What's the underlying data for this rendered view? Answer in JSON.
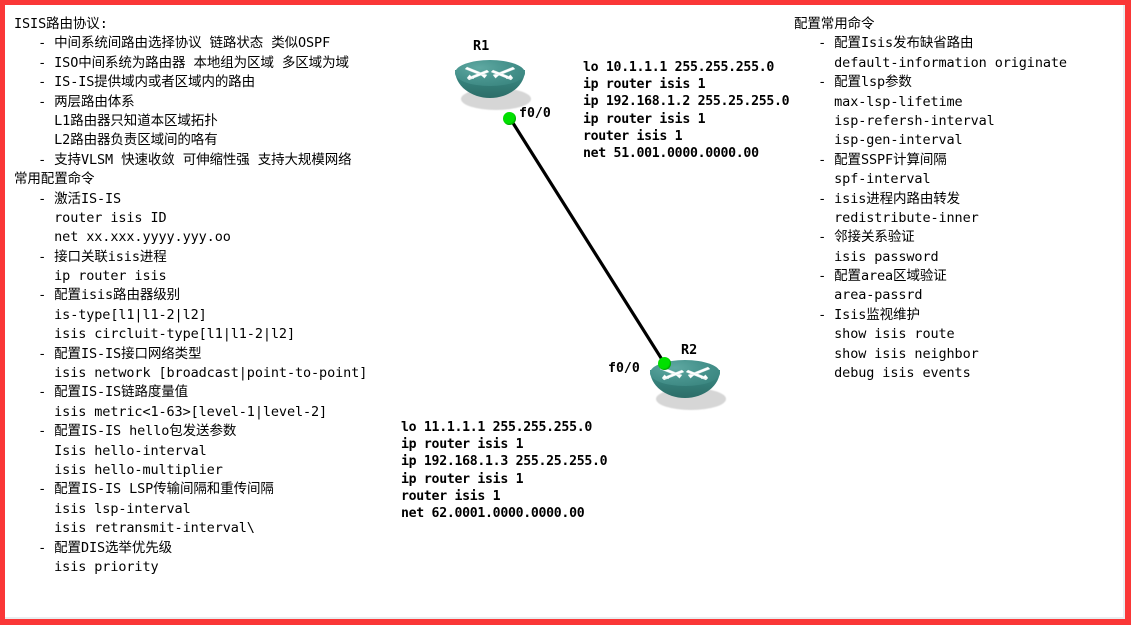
{
  "theme": {
    "frame_color": "#fa3737",
    "canvas_color": "#ffffff",
    "router_color": "#35807a",
    "link_color": "#000000",
    "status_dot_color": "#00e000"
  },
  "left_notes": {
    "lines": [
      "ISIS路由协议:",
      "   - 中间系统间路由选择协议 链路状态 类似OSPF",
      "   - ISO中间系统为路由器 本地组为区域 多区域为域",
      "   - IS-IS提供域内或者区域内的路由",
      "   - 两层路由体系",
      "     L1路由器只知道本区域拓扑",
      "     L2路由器负责区域间的咯有",
      "   - 支持VLSM 快速收敛 可伸缩性强 支持大规模网络",
      "常用配置命令",
      "   - 激活IS-IS",
      "     router isis ID",
      "     net xx.xxx.yyyy.yyy.oo",
      "   - 接口关联isis进程",
      "     ip router isis",
      "   - 配置isis路由器级别",
      "     is-type[l1|l1-2|l2]",
      "     isis circluit-type[l1|l1-2|l2]",
      "   - 配置IS-IS接口网络类型",
      "     isis network [broadcast|point-to-point]",
      "   - 配置IS-IS链路度量值",
      "     isis metric<1-63>[level-1|level-2]",
      "   - 配置IS-IS hello包发送参数",
      "     Isis hello-interval",
      "     isis hello-multiplier",
      "   - 配置IS-IS LSP传输间隔和重传间隔",
      "     isis lsp-interval",
      "     isis retransmit-interval\\",
      "   - 配置DIS选举优先级",
      "     isis priority"
    ]
  },
  "right_notes": {
    "lines": [
      "配置常用命令",
      "   - 配置Isis发布缺省路由",
      "     default-information originate",
      "   - 配置lsp参数",
      "     max-lsp-lifetime",
      "     isp-refersh-interval",
      "     isp-gen-interval",
      "   - 配置SSPF计算间隔",
      "     spf-interval",
      "   - isis进程内路由转发",
      "     redistribute-inner",
      "   - 邻接关系验证",
      "     isis password",
      "   - 配置area区域验证",
      "     area-passrd",
      "   - Isis监视维护",
      "     show isis route",
      "     show isis neighbor",
      "     debug isis events"
    ]
  },
  "topology": {
    "routers": [
      {
        "id": "R1",
        "label": "R1",
        "interface_label": "f0/0"
      },
      {
        "id": "R2",
        "label": "R2",
        "interface_label": "f0/0"
      }
    ],
    "link": {
      "from": "R1",
      "to": "R2",
      "interface_a": "f0/0",
      "interface_b": "f0/0"
    }
  },
  "r1_config": {
    "lines": [
      "lo 10.1.1.1 255.255.255.0",
      "ip router isis 1",
      "ip 192.168.1.2 255.25.255.0",
      "ip router isis 1",
      "router isis 1",
      "net 51.001.0000.0000.00"
    ]
  },
  "r2_config": {
    "lines": [
      "lo 11.1.1.1 255.255.255.0",
      "ip router isis 1",
      "ip 192.168.1.3 255.25.255.0",
      "ip router isis 1",
      "router isis 1",
      "net 62.0001.0000.0000.00"
    ]
  }
}
